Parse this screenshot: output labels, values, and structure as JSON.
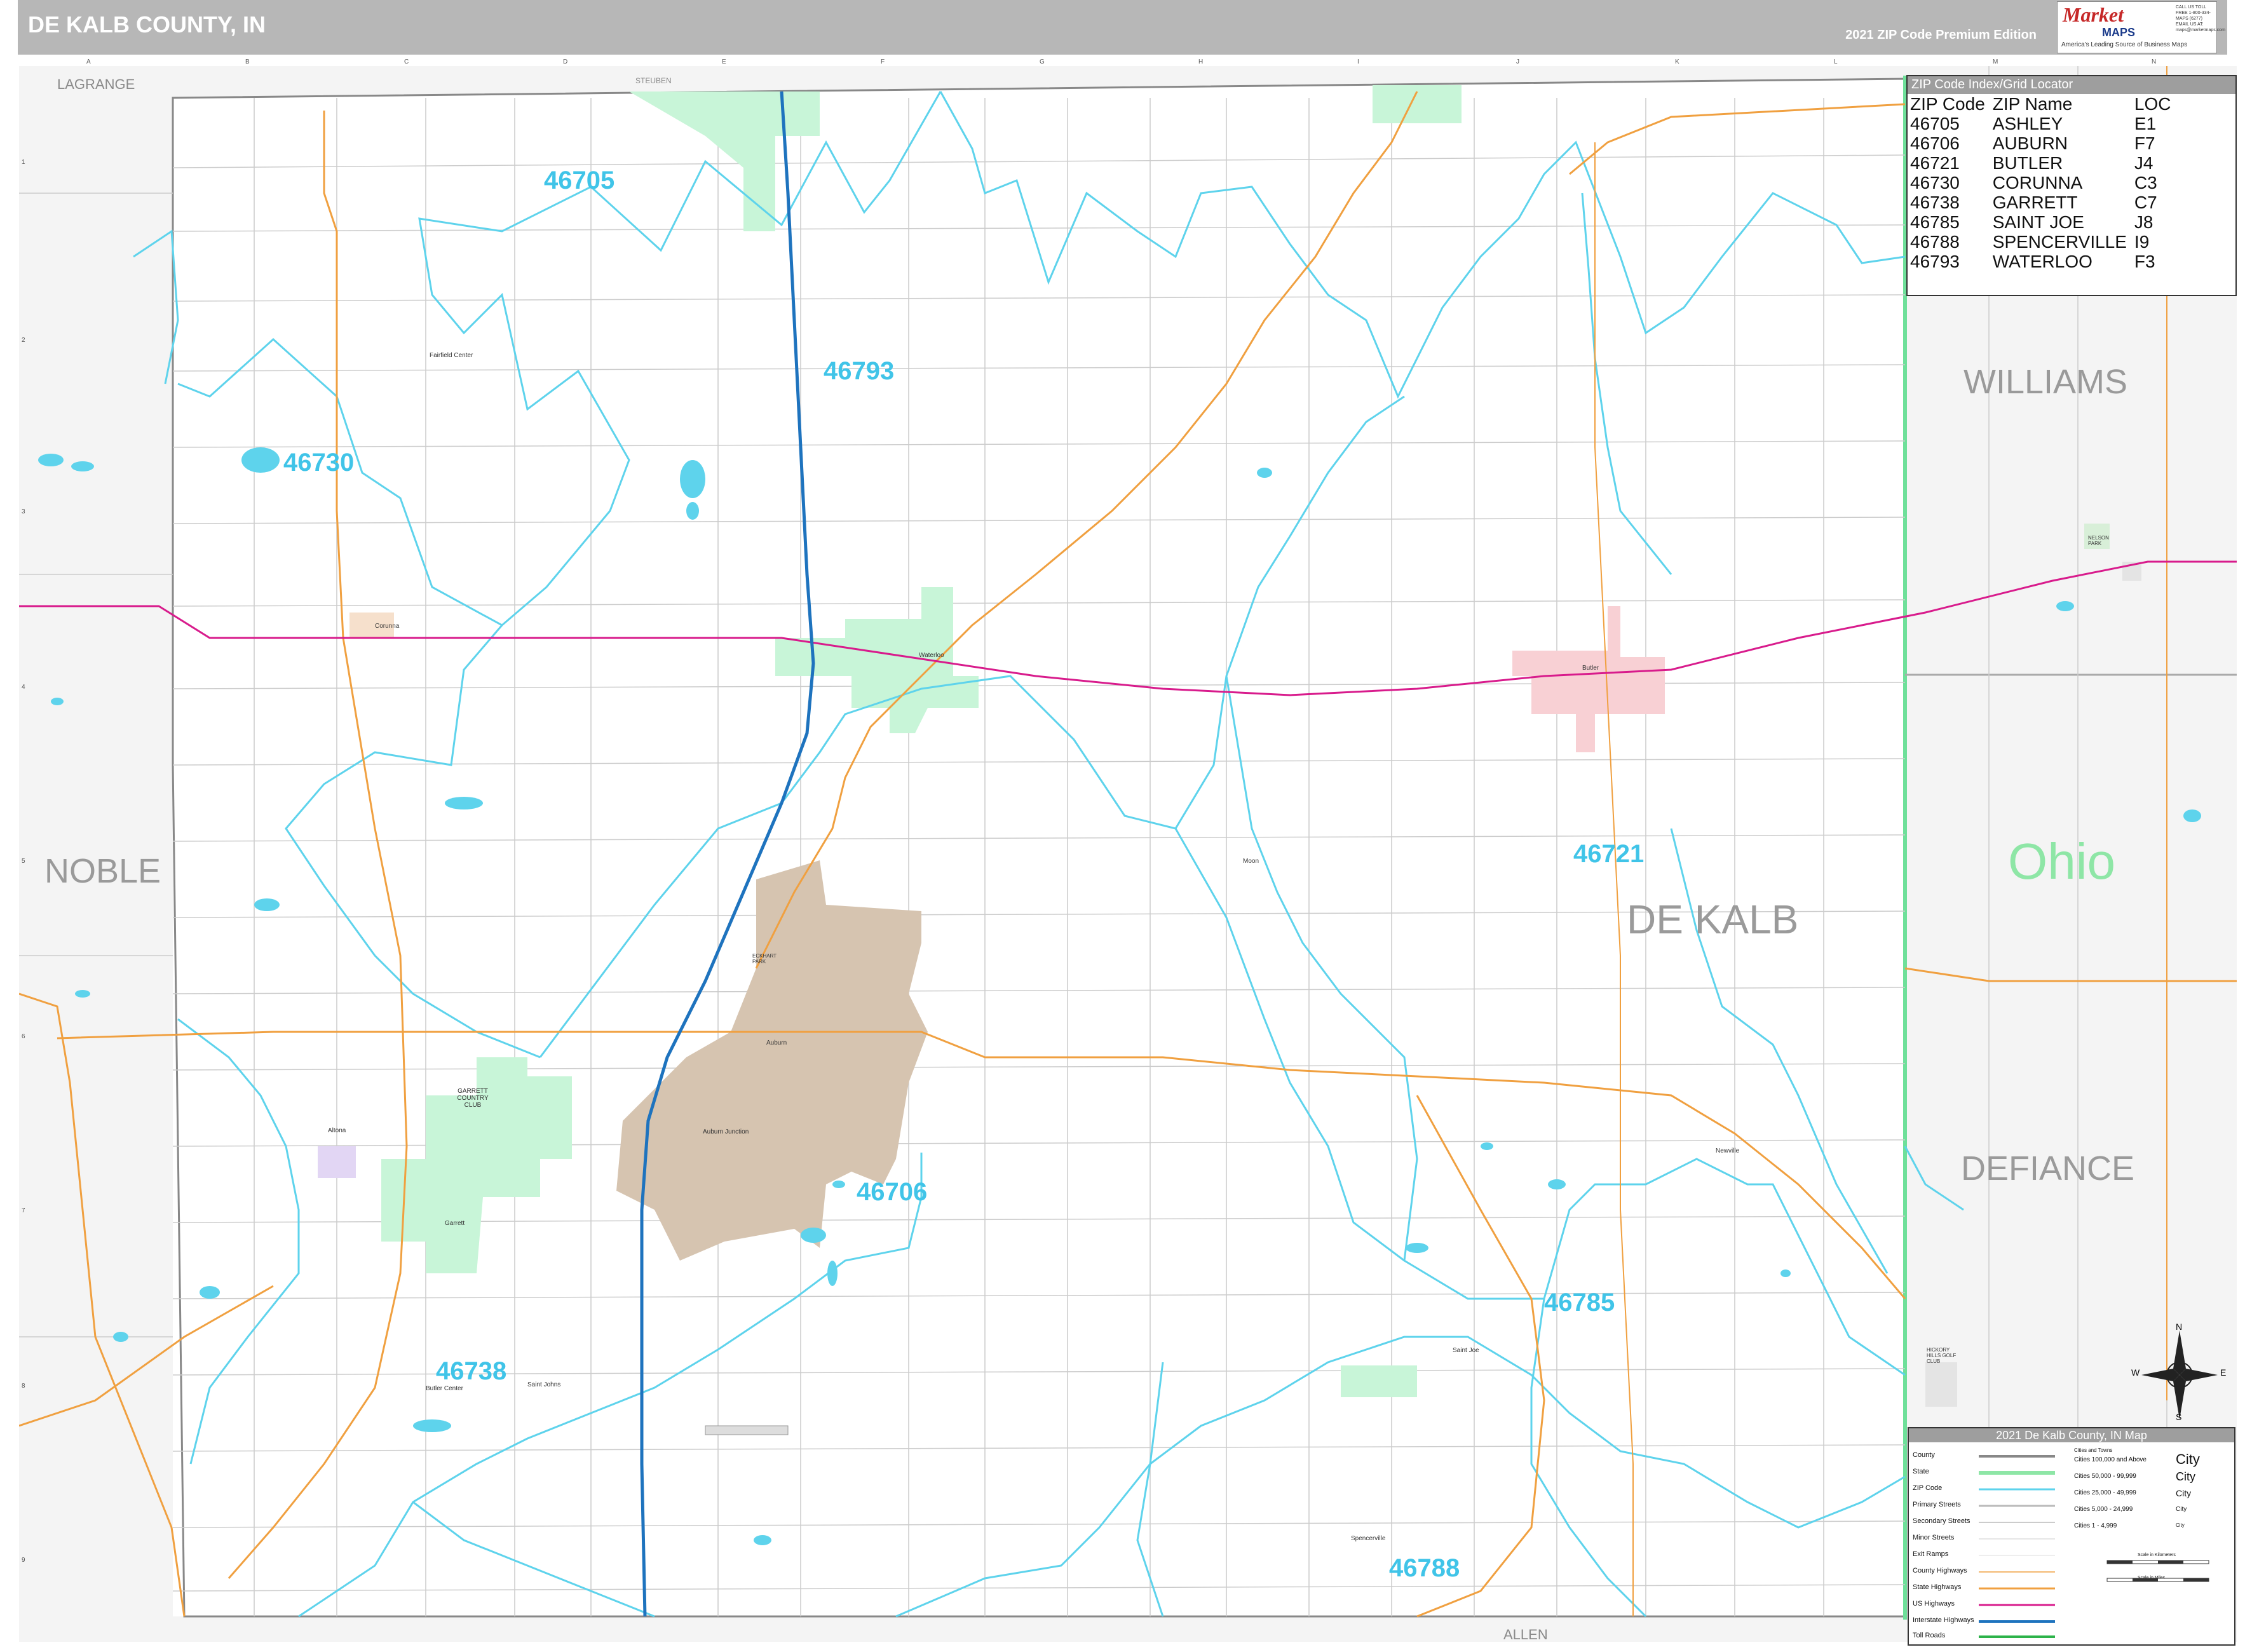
{
  "header": {
    "title": "DE KALB COUNTY, IN",
    "edition": "2021 ZIP Code Premium Edition",
    "logo_brand": "Market",
    "logo_brand2": "MAPS",
    "logo_tagline": "America's Leading Source of Business Maps",
    "logo_contact": "CALL US TOLL FREE 1-800-334-MAPS (6277) EMAIL US AT: maps@marketmaps.com"
  },
  "zip_index": {
    "title": "ZIP Code Index/Grid Locator",
    "columns": [
      "ZIP Code",
      "ZIP Name",
      "LOC"
    ],
    "rows": [
      [
        "46705",
        "ASHLEY",
        "E1"
      ],
      [
        "46706",
        "AUBURN",
        "F7"
      ],
      [
        "46721",
        "BUTLER",
        "J4"
      ],
      [
        "46730",
        "CORUNNA",
        "C3"
      ],
      [
        "46738",
        "GARRETT",
        "C7"
      ],
      [
        "46785",
        "SAINT JOE",
        "J8"
      ],
      [
        "46788",
        "SPENCERVILLE",
        "I9"
      ],
      [
        "46793",
        "WATERLOO",
        "F3"
      ]
    ]
  },
  "legend": {
    "title": "2021 De Kalb County, IN Map",
    "items": [
      "County",
      "State",
      "ZIP Code",
      "Primary Streets",
      "Secondary Streets",
      "Minor Streets",
      "Exit Ramps",
      "County Highways",
      "State Highways",
      "US Highways",
      "Interstate Highways",
      "Toll Roads"
    ],
    "city_header": "Cities and Towns",
    "cities": [
      "Cities 100,000 and Above",
      "Cities 50,000 - 99,999",
      "Cities 25,000 - 49,999",
      "Cities 5,000 - 24,999",
      "Cities 1 - 4,999"
    ],
    "city_samples": [
      "City",
      "City",
      "City",
      "City",
      "City"
    ],
    "scale_km": "Scale in Kilometers",
    "scale_mi": "Scale in Miles"
  },
  "map": {
    "zip_labels": [
      "46705",
      "46793",
      "46730",
      "46721",
      "46706",
      "46785",
      "46738",
      "46788"
    ],
    "region_labels": {
      "noble": "NOBLE",
      "williams": "WILLIAMS",
      "defiance": "DEFIANCE",
      "ohio": "Ohio",
      "dekalb": "DE KALB"
    },
    "border_labels": {
      "lagrange": "LAGRANGE",
      "steuben": "STEUBEN",
      "allen": "ALLEN"
    },
    "places": [
      "Fairfield Center",
      "Corunna",
      "Waterloo",
      "Butler",
      "Moon",
      "Auburn",
      "Auburn Junction",
      "Garrett",
      "Altona",
      "Newville",
      "Saint Joe",
      "Spencerville",
      "Butler Center",
      "Saint Johns"
    ],
    "map_labels": [
      "GARRETT COUNTRY CLUB",
      "NELSON PARK",
      "ECKHART PARK",
      "HICKORY HILLS GOLF CLUB"
    ],
    "grid_cols": [
      "A",
      "B",
      "C",
      "D",
      "E",
      "F",
      "G",
      "H",
      "I",
      "J",
      "K",
      "L",
      "M",
      "N"
    ],
    "grid_rows": [
      "1",
      "2",
      "3",
      "4",
      "5",
      "6",
      "7",
      "8",
      "9"
    ],
    "compass": [
      "N",
      "S",
      "E",
      "W"
    ],
    "colors": {
      "zip_label": "#40c4e8",
      "zip_boundary": "#5ed3ec",
      "interstate": "#1e73be",
      "us_highway": "#d81b8c",
      "state_highway": "#f0a040",
      "auburn_fill": "#d6c4b0",
      "waterloo_fill": "#c8f5d8",
      "butler_fill": "#f8d0d4",
      "state_line": "#6fe09a"
    }
  }
}
